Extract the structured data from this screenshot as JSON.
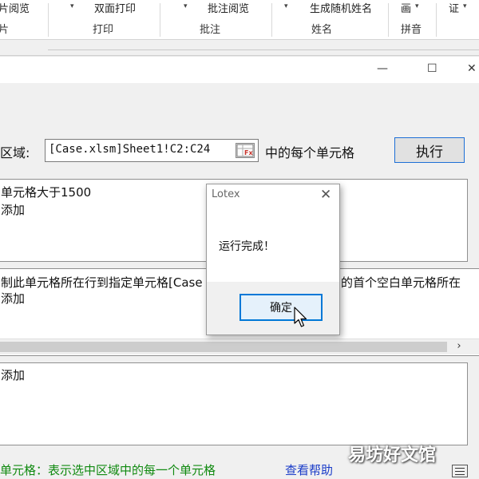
{
  "ribbon": {
    "top_labels": [
      "片阅览",
      "双面打印",
      "批注阅览",
      "生成随机姓名",
      "画",
      "证"
    ],
    "groups": [
      "片",
      "打印",
      "批注",
      "姓名",
      "拼音"
    ]
  },
  "window": {
    "controls": {
      "minimize": "—",
      "maximize": "☐",
      "close": "✕"
    }
  },
  "range": {
    "label": "区域:",
    "value": "[Case.xlsm]Sheet1!C2:C24",
    "suffix": "中的每个单元格",
    "picker_icon": "range-picker-icon",
    "picker_text": "Fx"
  },
  "run_button": "执行",
  "panels": {
    "p1_line1": "单元格大于1500",
    "p1_line2": "添加",
    "p2_line1_left": "制此单元格所在行到指定单元格[Case",
    "p2_line1_right": "的首个空白单元格所在",
    "p2_line2": "添加",
    "p3_line1": "添加"
  },
  "scroll_right": "›",
  "footer": {
    "description": "单元格：表示选中区域中的每一个单元格",
    "help": "查看帮助"
  },
  "watermark": "易坊好文馆",
  "dialog": {
    "title": "Lotex",
    "close": "✕",
    "message": "运行完成！",
    "ok": "确定"
  },
  "colors": {
    "accent": "#0078d7",
    "help_link": "#1a3cc8",
    "footer_text": "#108a10"
  }
}
